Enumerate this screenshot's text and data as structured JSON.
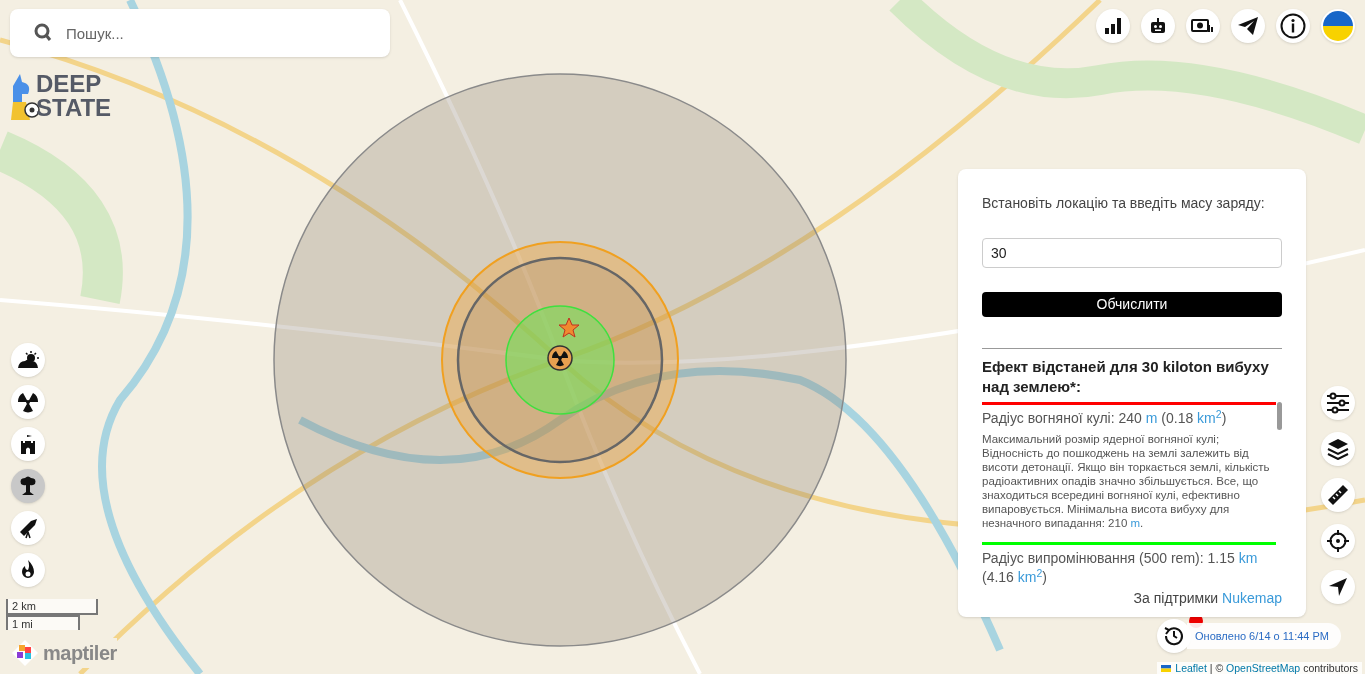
{
  "search": {
    "placeholder": "Пошук..."
  },
  "logo": {
    "line_1": "DEEP",
    "line_2": "STATE"
  },
  "top_buttons": [
    {
      "kind": "stats"
    },
    {
      "kind": "robot"
    },
    {
      "kind": "money"
    },
    {
      "kind": "telegram"
    },
    {
      "kind": "info"
    },
    {
      "kind": "flag"
    }
  ],
  "left_tools": [
    {
      "kind": "cloud",
      "selected": false
    },
    {
      "kind": "radiation",
      "selected": false
    },
    {
      "kind": "castle",
      "selected": false
    },
    {
      "kind": "mushroom",
      "selected": true
    },
    {
      "kind": "missile",
      "selected": false
    },
    {
      "kind": "fire",
      "selected": false
    }
  ],
  "right_tools": [
    {
      "kind": "sliders"
    },
    {
      "kind": "layers"
    },
    {
      "kind": "ruler"
    },
    {
      "kind": "crosshair"
    },
    {
      "kind": "locate"
    }
  ],
  "scale": {
    "metric": "2 km",
    "imperial": "1 mi"
  },
  "maptiler": {
    "label": "maptiler"
  },
  "panel": {
    "prompt": "Встановіть локацію та введіть масу заряду:",
    "yield_value": "30",
    "button": "Обчислити",
    "heading": "Ефект відстаней для 30 kiloton вибуху над землею*:",
    "effects": [
      {
        "color": "#ff0000",
        "title": [
          {
            "text": "Радіус вогняної кулі: 240 "
          },
          {
            "text": "m",
            "link": true
          },
          {
            "text": " (0.18 "
          },
          {
            "text": "km$^{2}$",
            "link": true
          },
          {
            "text": ")"
          }
        ],
        "description": [
          {
            "text": "Максимальний розмір ядерної вогняної кулі; Відносність до пошкоджень на землі залежить від висоти детонації. Якщо він торкається землі, кількість радіоактивних опадів значно збільшується. Все, що знаходиться всередині вогняної кулі, ефективно випаровується. Мінімальна висота вибуху для незначного випадання: 210 "
          },
          {
            "text": "m",
            "link": true
          },
          {
            "text": "."
          }
        ]
      },
      {
        "color": "#00ff00",
        "title": [
          {
            "text": "Радіус випромінювання (500 rem): 1.15 "
          },
          {
            "text": "km",
            "link": true
          },
          {
            "text": " (4.16 "
          },
          {
            "text": "km$^{2}$",
            "link": true
          },
          {
            "text": ")"
          }
        ]
      }
    ],
    "credit": "За підтримки ",
    "credit_link": "Nukemap"
  },
  "update": {
    "text": "Оновлено 6/14 о 11:44 PM"
  },
  "attribution": [
    {
      "text": "Leaflet",
      "link": true
    },
    {
      "text": " | © ",
      "link": false
    },
    {
      "text": "OpenStreetMap",
      "link": true
    },
    {
      "text": " contributors",
      "link": false
    }
  ]
}
